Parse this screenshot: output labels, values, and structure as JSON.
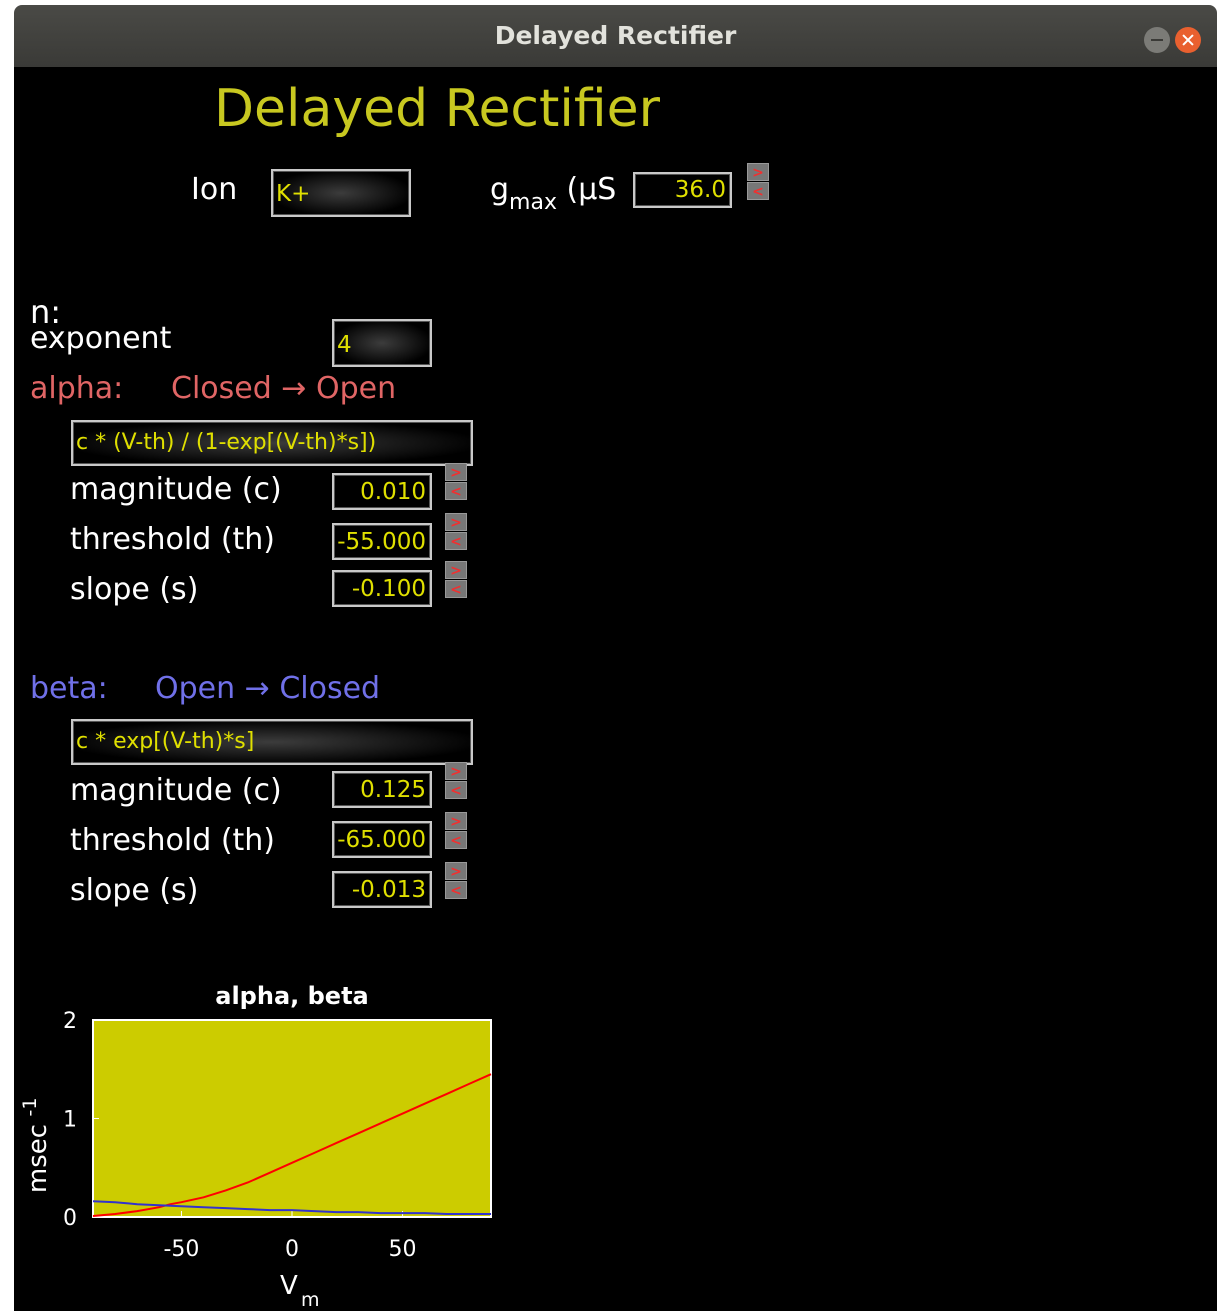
{
  "window": {
    "title": "Delayed Rectifier"
  },
  "header": {
    "title": "Delayed Rectifier"
  },
  "ion": {
    "label": "Ion",
    "value": "K+"
  },
  "gmax": {
    "label_main": "g",
    "label_sub": "max",
    "label_unit": " (μS",
    "value": "36.0"
  },
  "n": {
    "label": "n:",
    "exponent_label": "exponent",
    "exponent_value": "4"
  },
  "alpha": {
    "name": "alpha:",
    "transition": "Closed → Open",
    "formula": "c * (V-th) / (1-exp[(V-th)*s])",
    "magnitude_label": "magnitude (c)",
    "magnitude_value": "0.010",
    "threshold_label": "threshold (th)",
    "threshold_value": "-55.000",
    "slope_label": "slope (s)",
    "slope_value": "-0.100"
  },
  "beta": {
    "name": "beta:",
    "transition": "Open → Closed",
    "formula": "c * exp[(V-th)*s]",
    "magnitude_label": "magnitude (c)",
    "magnitude_value": "0.125",
    "threshold_label": "threshold (th)",
    "threshold_value": "-65.000",
    "slope_label": "slope (s)",
    "slope_value": "-0.013"
  },
  "stepper": {
    "up": ">",
    "down": "<"
  },
  "chart_data": {
    "type": "line",
    "title": "alpha, beta",
    "xlabel": "V",
    "xlabel_sub": "m",
    "ylabel": "msec",
    "ylabel_sup": "-1",
    "xlim": [
      -90,
      90
    ],
    "ylim": [
      0,
      2
    ],
    "xticks": [
      -50,
      0,
      50
    ],
    "yticks": [
      0,
      1,
      2
    ],
    "background": "#cccc00",
    "series": [
      {
        "color": "#ff0000",
        "x": [
          -90,
          -80,
          -70,
          -60,
          -55,
          -50,
          -40,
          -30,
          -20,
          -10,
          0,
          10,
          20,
          30,
          40,
          50,
          60,
          70,
          80,
          90
        ],
        "y": [
          0.01,
          0.03,
          0.06,
          0.1,
          0.13,
          0.15,
          0.2,
          0.27,
          0.35,
          0.45,
          0.55,
          0.65,
          0.75,
          0.85,
          0.95,
          1.05,
          1.15,
          1.25,
          1.35,
          1.45
        ]
      },
      {
        "color": "#3333cc",
        "x": [
          -90,
          -80,
          -70,
          -60,
          -50,
          -40,
          -30,
          -20,
          -10,
          0,
          10,
          20,
          30,
          40,
          50,
          60,
          70,
          80,
          90
        ],
        "y": [
          0.16,
          0.15,
          0.13,
          0.12,
          0.11,
          0.1,
          0.09,
          0.08,
          0.07,
          0.07,
          0.06,
          0.05,
          0.05,
          0.04,
          0.04,
          0.04,
          0.03,
          0.03,
          0.03
        ]
      }
    ]
  }
}
